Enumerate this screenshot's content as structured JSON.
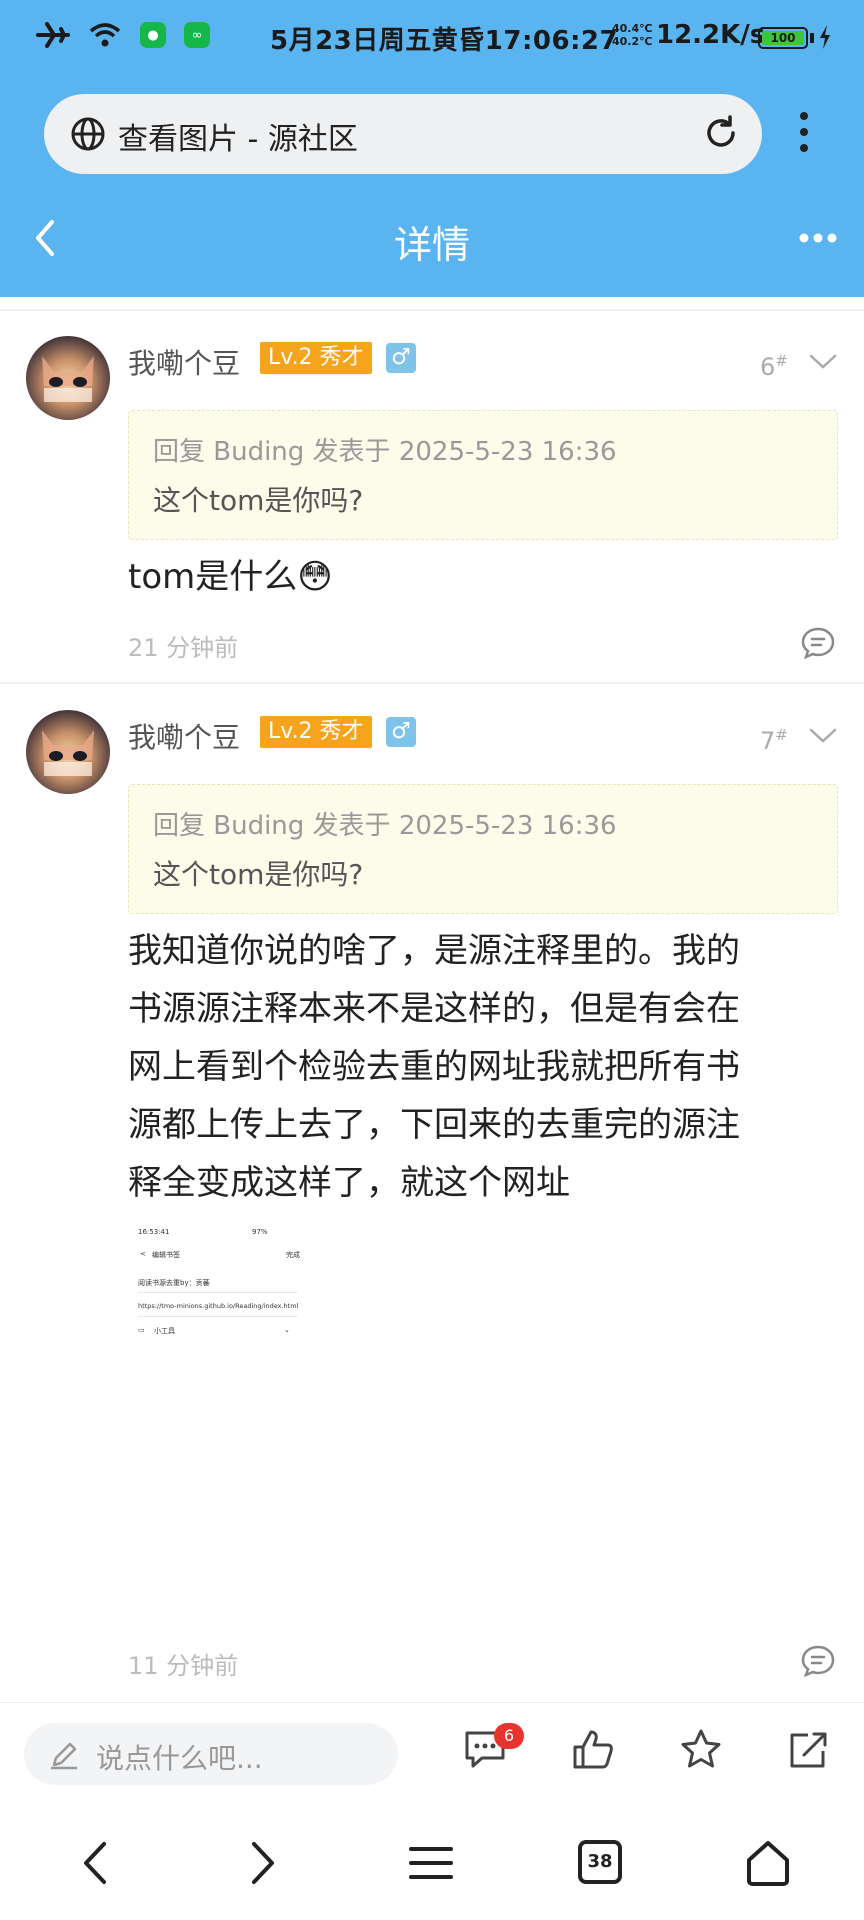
{
  "status_bar": {
    "time": "5月23日周五黄昏17:06:27",
    "temp_top": "40.4℃",
    "temp_bottom": "40.2℃",
    "speed": "12.2K/s",
    "battery": "100"
  },
  "browser": {
    "url_title": "查看图片 - 源社区"
  },
  "header": {
    "title": "详情"
  },
  "posts": [
    {
      "author": "我嘞个豆",
      "level": "Lv.2 秀才",
      "gender": "♂",
      "floor": "6",
      "floor_mark": "#",
      "quote_meta": "回复 Buding 发表于 2025-5-23 16:36",
      "quote_text": "这个tom是你吗?",
      "content": "tom是什么😳",
      "time": "21 分钟前"
    },
    {
      "author": "我嘞个豆",
      "level": "Lv.2 秀才",
      "gender": "♂",
      "floor": "7",
      "floor_mark": "#",
      "quote_meta": "回复 Buding 发表于 2025-5-23 16:36",
      "quote_text": "这个tom是你吗?",
      "content_lines": [
        "我知道你说的啥了，是源注释里的。我的",
        "书源源注释本来不是这样的，但是有会在",
        "网上看到个检验去重的网址我就把所有书",
        "源都上传上去了，下回来的去重完的源注",
        "释全变成这样了，就这个网址"
      ],
      "image": {
        "status_left": "16:53:41",
        "status_right": "97%",
        "title": "编辑书签",
        "action": "完成",
        "label": "阅读书源去重by：贡蕃",
        "url": "https://tmo-minions.github.io/Reading/index.html",
        "folder": "小工具"
      },
      "time": "11 分钟前"
    }
  ],
  "bottom_bar": {
    "input_placeholder": "说点什么吧...",
    "comment_count": "6"
  },
  "system_nav": {
    "tab_count": "38"
  }
}
